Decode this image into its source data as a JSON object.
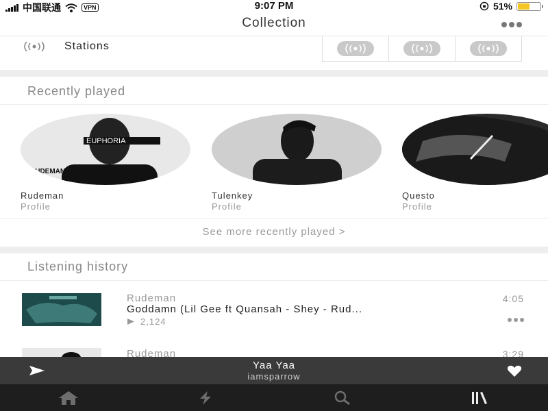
{
  "status_bar": {
    "carrier": "中国联通",
    "vpn": "VPN",
    "time": "9:07 PM",
    "battery_percent": "51%",
    "battery_level": 0.51
  },
  "header": {
    "title": "Collection"
  },
  "stations": {
    "label": "Stations"
  },
  "recently_played": {
    "title": "Recently played",
    "items": [
      {
        "name": "Rudeman",
        "type": "Profile"
      },
      {
        "name": "Tulenkey",
        "type": "Profile"
      },
      {
        "name": "Questo",
        "type": "Profile"
      }
    ],
    "see_more": "See more recently played"
  },
  "listening_history": {
    "title": "Listening history",
    "rows": [
      {
        "artist": "Rudeman",
        "title": "Goddamn (Lil Gee ft Quansah - Shey - Rud...",
        "plays": "2,124",
        "duration": "4:05"
      },
      {
        "artist": "Rudeman",
        "duration": "3:29"
      }
    ]
  },
  "now_playing": {
    "song": "Yaa Yaa",
    "artist": "iamsparrow"
  },
  "colors": {
    "accent": "#f3c623",
    "player_bg": "#3a3a3a",
    "tabbar_bg": "#1e1e1e"
  }
}
